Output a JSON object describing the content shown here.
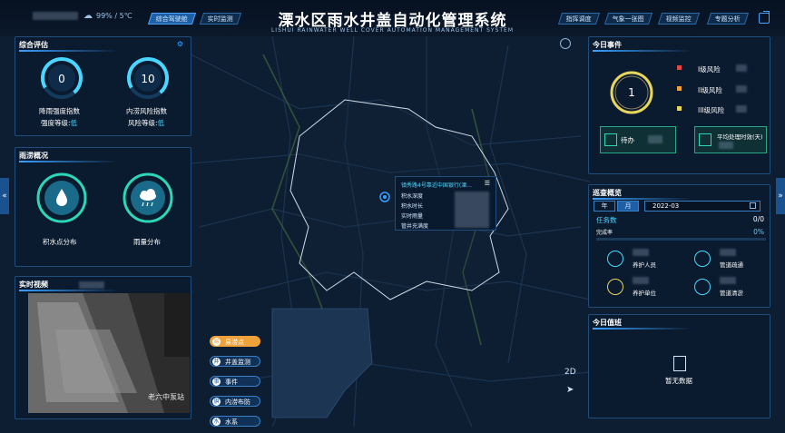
{
  "header": {
    "title": "溧水区雨水井盖自动化管理系统",
    "subtitle": "LISHUI RAINWATER WELL COVER AUTOMATION MANAGEMENT SYSTEM",
    "weather": "99% / 5℃",
    "nav_left": [
      "综合驾驶舱",
      "实时监测"
    ],
    "nav_right": [
      "指挥调度",
      "气象一张图",
      "视频监控",
      "专题分析"
    ]
  },
  "overview": {
    "title": "综合评估",
    "gauges": [
      {
        "value": "0",
        "label": "降雨强度指数",
        "sub_key": "强度等级:",
        "sub_val": "低"
      },
      {
        "value": "10",
        "label": "内涝风险指数",
        "sub_key": "风险等级:",
        "sub_val": "低"
      }
    ]
  },
  "rain": {
    "title": "雨涝概况",
    "items": [
      "积水点分布",
      "雨量分布"
    ]
  },
  "video": {
    "title": "实时视频",
    "station": "老六中泵站"
  },
  "popup": {
    "title": "镇秀路4号靠近中国银行(溧...",
    "rows": [
      "积水深度",
      "积水时长",
      "实时雨量",
      "管井充满度"
    ]
  },
  "menu": [
    "易涝点",
    "井盖监测",
    "事件",
    "内涝布防",
    "水系"
  ],
  "map_tools": {
    "mode": "2D"
  },
  "events": {
    "title": "今日事件",
    "count": "1",
    "levels": [
      {
        "label": "I级风险",
        "color": "#e84545"
      },
      {
        "label": "II级风险",
        "color": "#f0a23a"
      },
      {
        "label": "III级风险",
        "color": "#e8d65a"
      }
    ],
    "todo": "待办",
    "avg": "平均处理时效(天)"
  },
  "patrol": {
    "title": "巡查概览",
    "tabs": [
      "年",
      "月"
    ],
    "date": "2022-03",
    "task_label": "任务数",
    "task_val": "0/0",
    "rate_label": "完成率",
    "rate_val": "0%",
    "rate_progress": 0,
    "stats": [
      "养护人员",
      "管道疏通",
      "养护单位",
      "管道清淤"
    ]
  },
  "duty": {
    "title": "今日值班",
    "empty": "暂无数据"
  },
  "colors": {
    "accent": "#3aa0ff",
    "gauge": "#4ad7ff",
    "event_ring": "#e8d65a"
  }
}
